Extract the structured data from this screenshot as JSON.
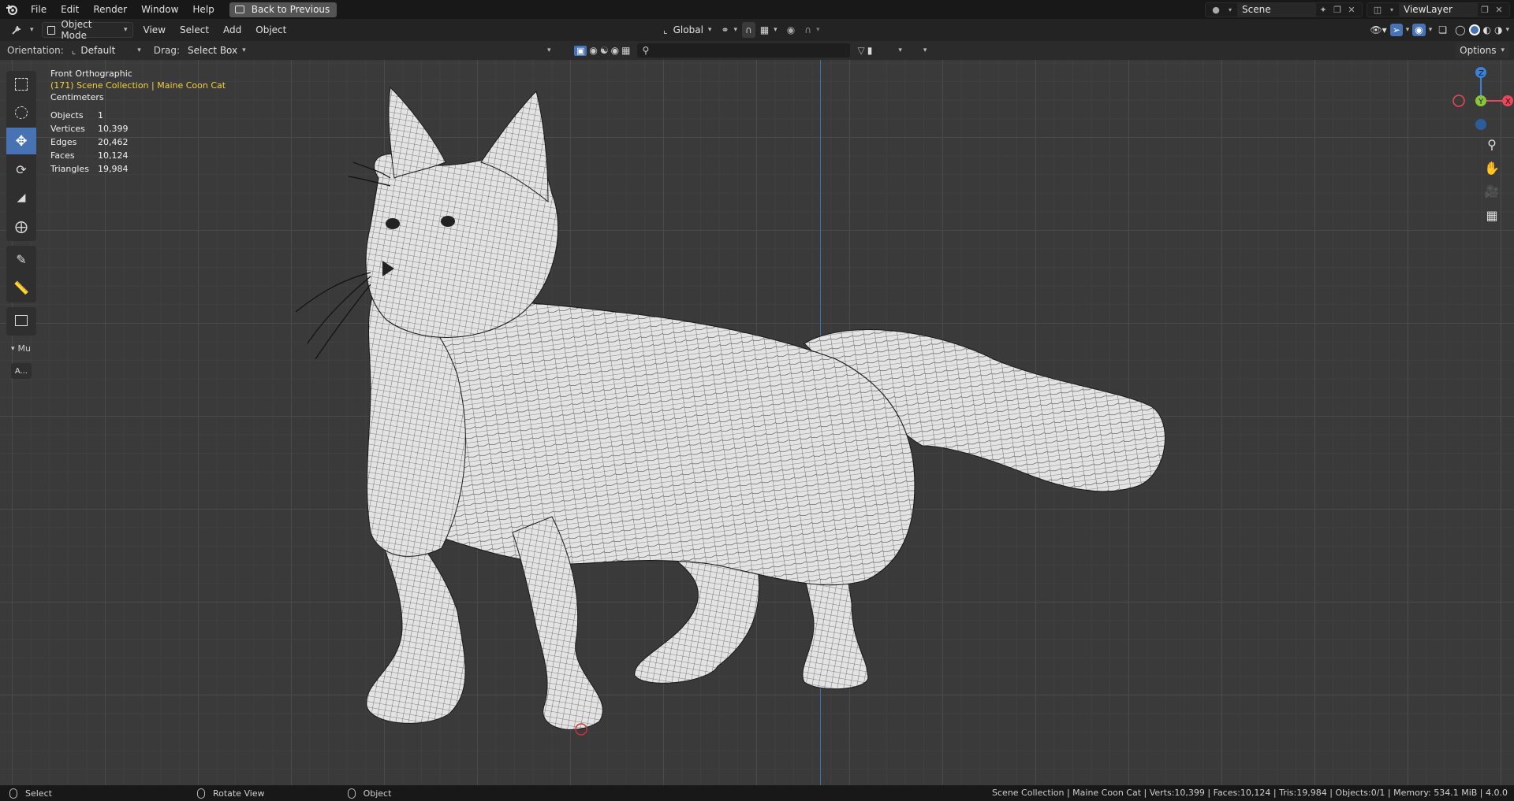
{
  "menu": {
    "items": [
      "File",
      "Edit",
      "Render",
      "Window",
      "Help"
    ],
    "back_button": "Back to Previous"
  },
  "scene": {
    "name": "Scene"
  },
  "view_layer": {
    "name": "ViewLayer"
  },
  "header": {
    "mode": "Object Mode",
    "menus": [
      "View",
      "Select",
      "Add",
      "Object"
    ],
    "transform_orientation": "Global"
  },
  "toolrow": {
    "orientation_label": "Orientation:",
    "orientation_value": "Default",
    "drag_label": "Drag:",
    "drag_value": "Select Box",
    "options_label": "Options"
  },
  "overlay": {
    "view_name": "Front Orthographic",
    "collection": "(171) Scene Collection | Maine Coon Cat",
    "units": "Centimeters",
    "stats": [
      {
        "label": "Objects",
        "value": "1"
      },
      {
        "label": "Vertices",
        "value": "10,399"
      },
      {
        "label": "Edges",
        "value": "20,462"
      },
      {
        "label": "Faces",
        "value": "10,124"
      },
      {
        "label": "Triangles",
        "value": "19,984"
      }
    ]
  },
  "toolbar_panel": {
    "collapsed_label": "Mu",
    "button_label": "A..."
  },
  "gizmo": {
    "x": "X",
    "y": "Y",
    "z": "Z"
  },
  "statusbar": {
    "select": "Select",
    "rotate": "Rotate View",
    "object": "Object",
    "info": "Scene Collection | Maine Coon Cat | Verts:10,399 | Faces:10,124 | Tris:19,984 | Objects:0/1 | Memory: 534.1 MiB | 4.0.0"
  },
  "colors": {
    "accent": "#4772b3",
    "x_axis": "#e8485a",
    "y_axis": "#8bc43f",
    "z_axis": "#3b82d6",
    "collection_text": "#f4d03f"
  }
}
